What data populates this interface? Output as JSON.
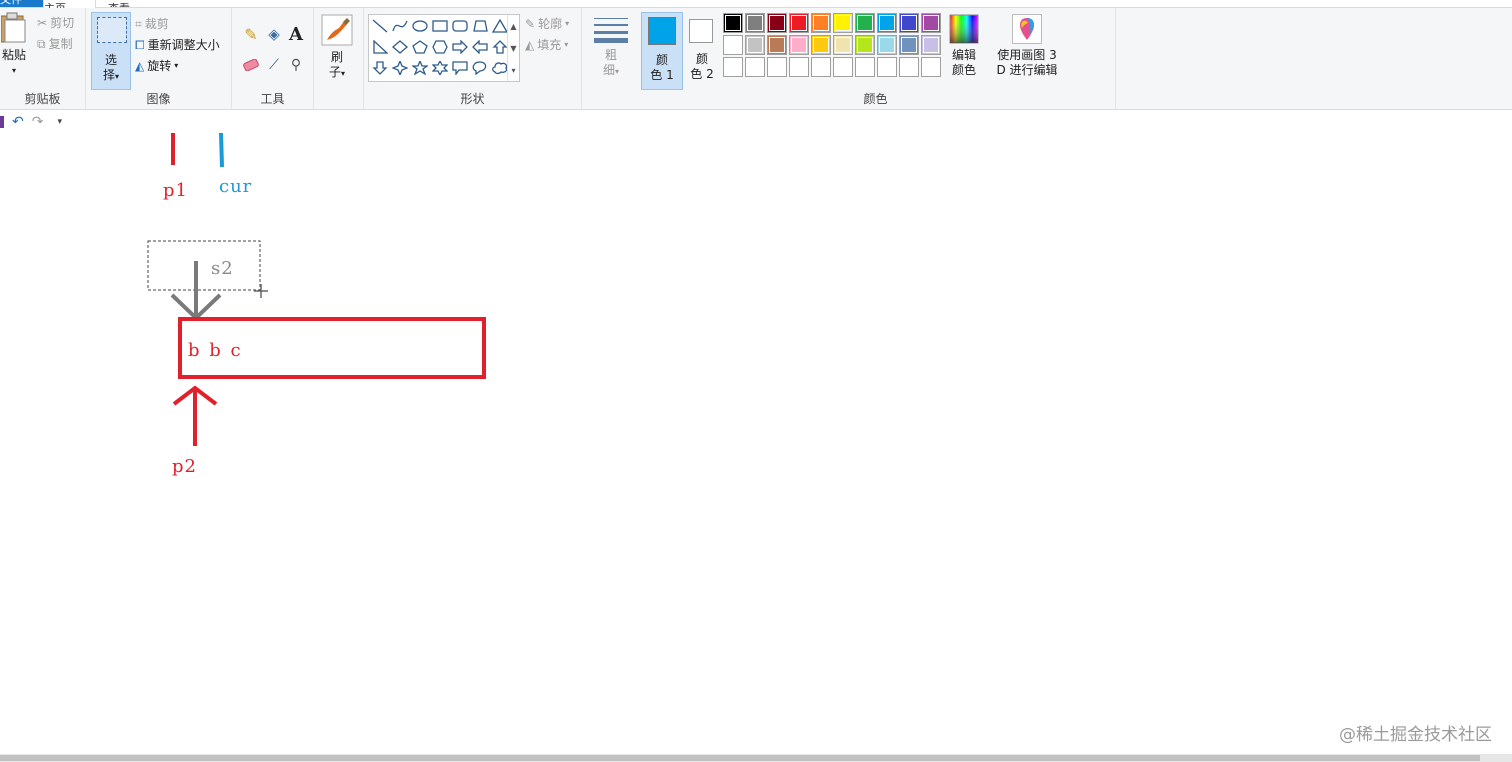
{
  "tabs": {
    "file": "文件",
    "home": "主页",
    "view": "查看"
  },
  "clipboard": {
    "paste_label": "粘贴",
    "cut_label": "剪切",
    "copy_label": "复制",
    "group_label": "剪贴板"
  },
  "image": {
    "select_line1": "选",
    "select_line2": "择",
    "crop_label": "裁剪",
    "resize_label": "重新调整大小",
    "rotate_label": "旋转",
    "group_label": "图像"
  },
  "tools": {
    "group_label": "工具",
    "text_glyph": "A"
  },
  "brushes": {
    "line1": "刷",
    "line2": "子"
  },
  "shapes": {
    "outline_label": "轮廓",
    "fill_label": "填充",
    "group_label": "形状"
  },
  "size": {
    "line1": "粗",
    "line2": "细"
  },
  "colors": {
    "color1_line1": "颜",
    "color1_line2": "色 1",
    "color2_line1": "颜",
    "color2_line2": "色 2",
    "edit_line1": "编辑",
    "edit_line2": "颜色",
    "paint3d_line1": "使用画图 3",
    "paint3d_line2": "D 进行编辑",
    "group_label": "颜色",
    "color1_value": "#00a2e8",
    "color2_value": "#ffffff",
    "palette": [
      "#000000",
      "#7f7f7f",
      "#880015",
      "#ed1c24",
      "#ff7f27",
      "#fff200",
      "#22b14c",
      "#00a2e8",
      "#3f48cc",
      "#a349a4",
      "#ffffff",
      "#c3c3c3",
      "#b97a57",
      "#ffaec9",
      "#ffc90e",
      "#efe4b0",
      "#b5e61d",
      "#99d9ea",
      "#7092be",
      "#c8bfe7",
      "#ffffff",
      "#ffffff",
      "#ffffff",
      "#ffffff",
      "#ffffff",
      "#ffffff",
      "#ffffff",
      "#ffffff",
      "#ffffff",
      "#ffffff"
    ]
  },
  "canvas": {
    "p1_label": "p1",
    "cur_label": "cur",
    "s2_label": "s2",
    "box_text": "b b c",
    "p2_label": "p2",
    "red": "#e0202a",
    "blue": "#1a9ad6",
    "gray": "#7a7a7a"
  },
  "watermark": "@稀土掘金技术社区"
}
